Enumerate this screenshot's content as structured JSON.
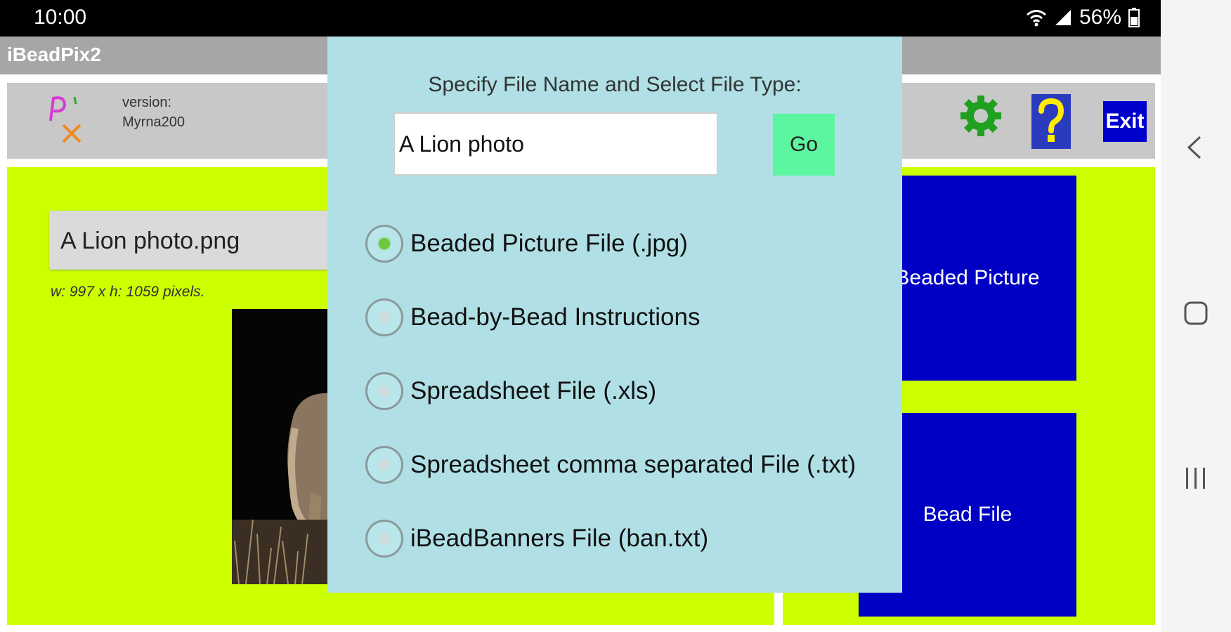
{
  "status_bar": {
    "time": "10:00",
    "battery": "56%"
  },
  "app": {
    "title": "iBeadPix2"
  },
  "toolbar": {
    "version_label": "version:",
    "version_value": "Myrna200",
    "exit_label": "Exit"
  },
  "left_panel": {
    "filename": "A Lion photo.png",
    "dimensions": "w: 997  x  h: 1059 pixels."
  },
  "right_panel": {
    "beaded_picture_label": "Beaded Picture",
    "bead_file_label": "Bead File"
  },
  "dialog": {
    "title": "Specify File Name and Select File Type:",
    "file_name_value": "A Lion photo",
    "go_label": "Go",
    "options": [
      {
        "label": "Beaded Picture File (.jpg)",
        "selected": true
      },
      {
        "label": "Bead-by-Bead Instructions",
        "selected": false
      },
      {
        "label": "Spreadsheet File (.xls)",
        "selected": false
      },
      {
        "label": "Spreadsheet comma separated File (.txt)",
        "selected": false
      },
      {
        "label": "iBeadBanners File (ban.txt)",
        "selected": false
      }
    ]
  },
  "colors": {
    "panel_green": "#ccff00",
    "button_blue": "#0000c4",
    "dialog_bg": "#b0e0e6",
    "go_green": "#5cf5a0"
  }
}
